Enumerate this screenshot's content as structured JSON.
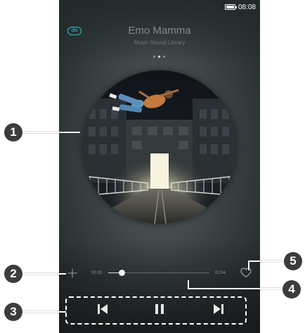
{
  "status_bar": {
    "time": "08:08",
    "battery_icon": "battery-icon"
  },
  "player": {
    "badge": "dts",
    "song_title": "Emo Mamma",
    "artist": "Music Sound Library",
    "page_indicator": {
      "pages": 3,
      "active": 2
    },
    "album_art": "album-cover-image",
    "progress": {
      "elapsed": "00:15",
      "total": "02:54",
      "fraction": 0.13
    },
    "icons": {
      "add": "plus-icon",
      "favorite": "heart-icon",
      "previous": "skip-previous-icon",
      "play_pause": "pause-icon",
      "next": "skip-next-icon"
    }
  },
  "callouts": [
    "1",
    "2",
    "3",
    "4",
    "5"
  ],
  "colors": {
    "accent": "#32c0c9",
    "callout_bg": "#3c3c3c",
    "screen_bg": "#2f3638"
  }
}
